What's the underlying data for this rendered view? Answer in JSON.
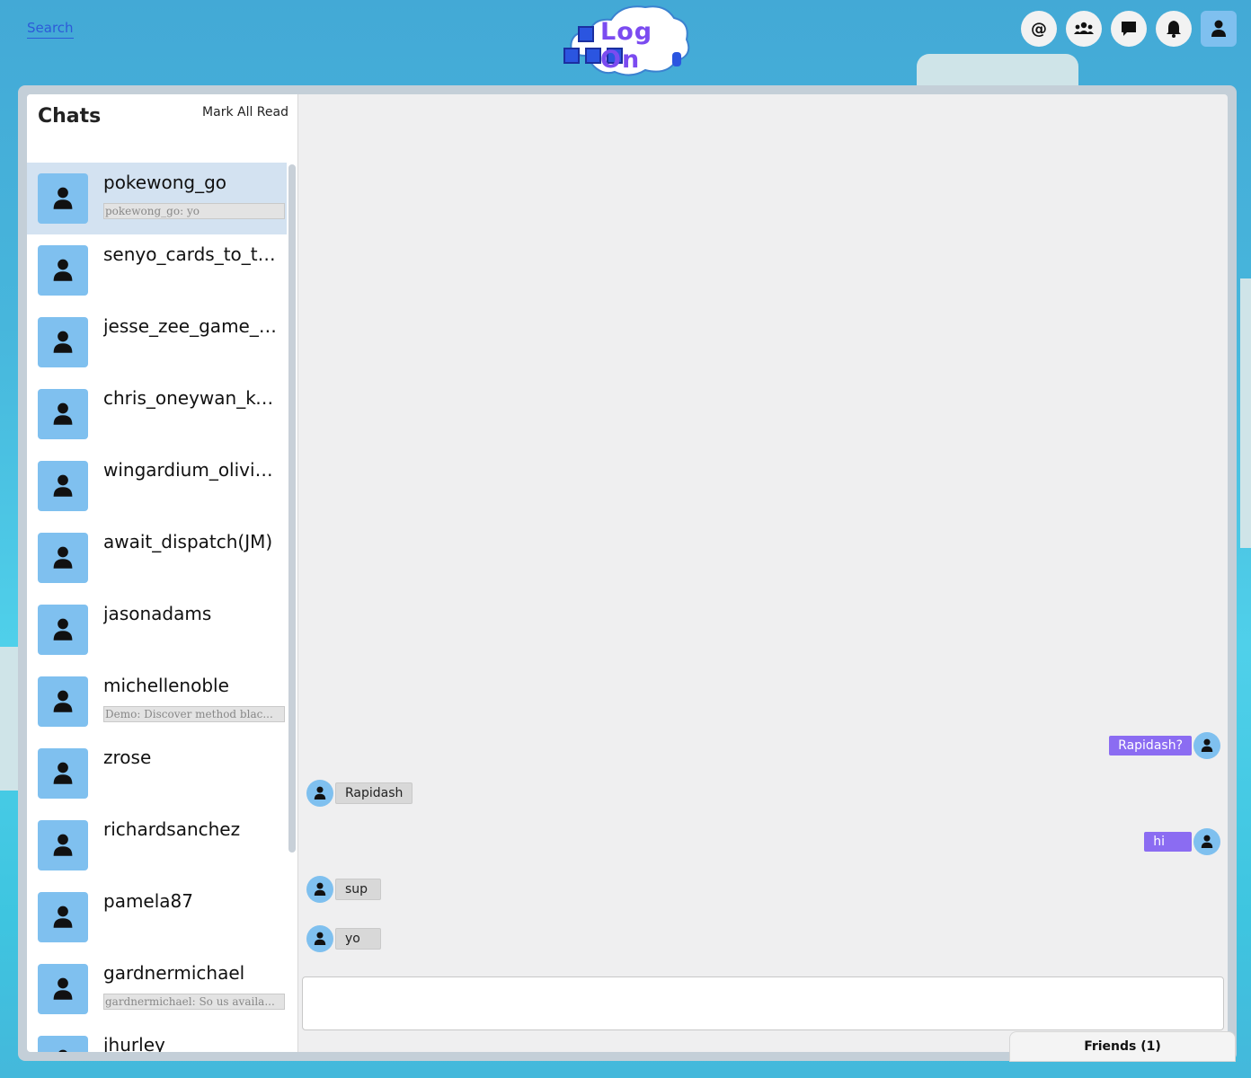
{
  "header": {
    "search_label": "Search",
    "logo_text": "Log On",
    "icons": [
      "at-icon",
      "users-icon",
      "chat-bubble-icon",
      "bell-icon",
      "user-icon"
    ],
    "at_symbol": "@"
  },
  "sidebar": {
    "title": "Chats",
    "mark_all_read": "Mark All Read",
    "chats": [
      {
        "name": "pokewong_go",
        "preview": "pokewong_go: yo",
        "active": true
      },
      {
        "name": "senyo_cards_to_th...",
        "preview": ""
      },
      {
        "name": "jesse_zee_game_ez...",
        "preview": ""
      },
      {
        "name": "chris_oneywan_ken...",
        "preview": ""
      },
      {
        "name": "wingardium_oliviosa",
        "preview": ""
      },
      {
        "name": "await_dispatch(JM)",
        "preview": ""
      },
      {
        "name": "jasonadams",
        "preview": ""
      },
      {
        "name": "michellenoble",
        "preview": "Demo: Discover method blac..."
      },
      {
        "name": "zrose",
        "preview": ""
      },
      {
        "name": "richardsanchez",
        "preview": ""
      },
      {
        "name": "pamela87",
        "preview": ""
      },
      {
        "name": "gardnermichael",
        "preview": "gardnermichael: So us availa..."
      },
      {
        "name": "jhurley",
        "preview": ""
      }
    ]
  },
  "messages": [
    {
      "text": "Rapidash?",
      "from": "me"
    },
    {
      "text": "Rapidash",
      "from": "them"
    },
    {
      "text": "hi",
      "from": "me"
    },
    {
      "text": "sup",
      "from": "them"
    },
    {
      "text": "yo",
      "from": "them"
    }
  ],
  "composer": {
    "value": ""
  },
  "friends_tab": {
    "label": "Friends (1)"
  },
  "colors": {
    "accent": "#8b6cf2",
    "avatar": "#7fc0ef",
    "active_row": "#d3e2f1"
  }
}
